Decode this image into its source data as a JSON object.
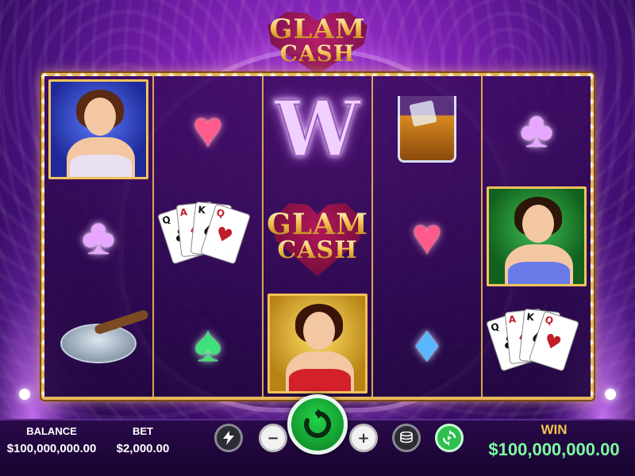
{
  "game": {
    "logo_line1": "GLAM",
    "logo_line2": "CASH"
  },
  "reels": [
    [
      "portrait-blue",
      "club",
      "ashtray"
    ],
    [
      "heart",
      "cards",
      "spade"
    ],
    [
      "wild",
      "logo",
      "portrait-gold"
    ],
    [
      "whisky",
      "heart",
      "diamond"
    ],
    [
      "club",
      "portrait-green",
      "cards"
    ]
  ],
  "symbols": {
    "wild_letter": "W",
    "heart_glyph": "♥",
    "club_glyph": "♣",
    "spade_glyph": "♠",
    "diamond_glyph": "♦"
  },
  "cards_hand": [
    {
      "rank": "Q",
      "suit": "♣",
      "color": "black"
    },
    {
      "rank": "A",
      "suit": "♦",
      "color": "red"
    },
    {
      "rank": "K",
      "suit": "♠",
      "color": "black"
    },
    {
      "rank": "Q",
      "suit": "♥",
      "color": "red"
    }
  ],
  "bottom_bar": {
    "balance_label": "BALANCE",
    "balance_value": "$100,000,000.00",
    "bet_label": "BET",
    "bet_value": "$2,000.00",
    "win_label": "WIN",
    "win_value": "$100,000,000.00",
    "turbo_icon": "lightning-icon",
    "minus_glyph": "−",
    "plus_glyph": "+",
    "spin_icon": "spin-arrow-icon",
    "stack_icon": "coin-stack-icon",
    "autoplay_icon": "autoplay-icon"
  },
  "colors": {
    "frame_gold": "#e7b65a",
    "spin_green": "#25d44a",
    "win_green": "#7dffa0",
    "win_label_gold": "#f2c14e"
  }
}
